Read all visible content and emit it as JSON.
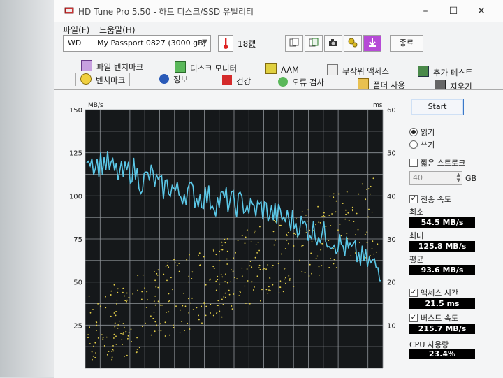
{
  "window": {
    "title": "HD Tune Pro 5.50 - 하드 디스크/SSD 유틸리티"
  },
  "menu": {
    "file": "파일(F)",
    "help": "도움말(H)"
  },
  "toolbar": {
    "drive_vendor": "WD",
    "drive_name": "My Passport 0827 (3000 gB)",
    "temperature": "18캜",
    "exit_label": "종료",
    "icons": [
      "copy-info-icon",
      "copy-text-icon",
      "camera-icon",
      "options-icon",
      "save-download-icon"
    ]
  },
  "tabs": {
    "row1": [
      "파일 벤치마크",
      "디스크 모니터",
      "AAM",
      "무작위 액세스",
      "추가 테스트"
    ],
    "row2": [
      "벤치마크",
      "정보",
      "건강",
      "오류 검사",
      "폴더 사용",
      "지우기"
    ]
  },
  "side": {
    "start": "Start",
    "read": "읽기",
    "write": "쓰기",
    "short_stroke": "짧은 스트로크",
    "stroke_value": "40",
    "stroke_unit": "GB",
    "transfer_rate": "전송 속도",
    "min_label": "최소",
    "min_value": "54.5 MB/s",
    "max_label": "최대",
    "max_value": "125.8 MB/s",
    "avg_label": "평균",
    "avg_value": "93.6 MB/s",
    "access_label": "액세스 시간",
    "access_value": "21.5 ms",
    "burst_label": "버스트 속도",
    "burst_value": "215.7 MB/s",
    "cpu_label": "CPU 사용량",
    "cpu_value": "23.4%"
  },
  "colors": {
    "transfer_line": "#5bc8e8",
    "access_dots": "#e8d24a",
    "grid": "#8f9499",
    "plot_bg": "#15181a"
  },
  "chart_data": {
    "type": "line",
    "ylabel_left": "MB/s",
    "ylabel_right": "ms",
    "ylim": [
      0,
      150
    ],
    "ylim_right": [
      0,
      60
    ],
    "yticks_left": [
      "150",
      "125",
      "100",
      "75",
      "50",
      "25"
    ],
    "yticks_right": [
      "60",
      "50",
      "40",
      "30",
      "20",
      "10"
    ],
    "grid": true,
    "series": [
      {
        "values": [
          126,
          118,
          120,
          114,
          112,
          116,
          108,
          112,
          104,
          106,
          101,
          103,
          99,
          100,
          96,
          98,
          95,
          96,
          92,
          93,
          90,
          88,
          86,
          84,
          81,
          79,
          77,
          74,
          70,
          67,
          63,
          60,
          57
        ]
      }
    ]
  }
}
